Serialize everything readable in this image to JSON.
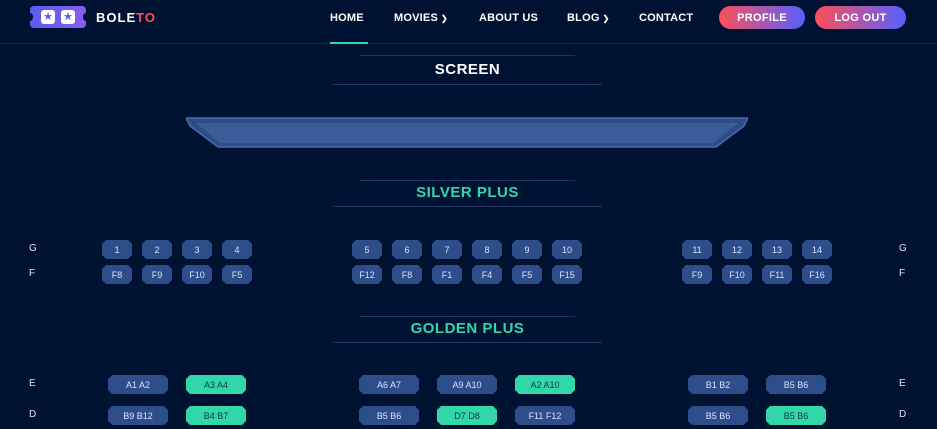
{
  "brand": {
    "name_main": "BOLE",
    "name_accent": "TO"
  },
  "nav": {
    "home": "HOME",
    "movies": "MOVIES",
    "about": "ABOUT US",
    "blog": "BLOG",
    "contact": "CONTACT"
  },
  "actions": {
    "profile": "PROFILE",
    "logout": "LOG OUT"
  },
  "screen_title": "SCREEN",
  "silver": {
    "title": "SILVER PLUS",
    "rows": [
      {
        "label": "G",
        "seats": [
          "1",
          "2",
          "3",
          "4",
          "5",
          "6",
          "7",
          "8",
          "9",
          "10",
          "11",
          "12",
          "13",
          "14"
        ]
      },
      {
        "label": "F",
        "seats": [
          "F8",
          "F9",
          "F10",
          "F5",
          "F12",
          "F8",
          "F1",
          "F4",
          "F5",
          "F15",
          "F9",
          "F10",
          "F11",
          "F16"
        ]
      }
    ]
  },
  "golden": {
    "title": "GOLDEN PLUS",
    "rows": [
      {
        "label": "E",
        "seats": [
          "A1 A2",
          "A3 A4",
          "A6 A7",
          "A9 A10",
          "A2 A10",
          "B1 B2",
          "B5 B6"
        ]
      },
      {
        "label": "D",
        "seats": [
          "B9 B12",
          "B4 B7",
          "B5 B6",
          "D7 D8",
          "F11 F12",
          "B5 B6",
          "B5 B6"
        ]
      }
    ]
  },
  "colors": {
    "background": "#001232",
    "accent": "#31d7a9",
    "seat": "#2d4e8a",
    "brand_red": "#ff4f58"
  }
}
